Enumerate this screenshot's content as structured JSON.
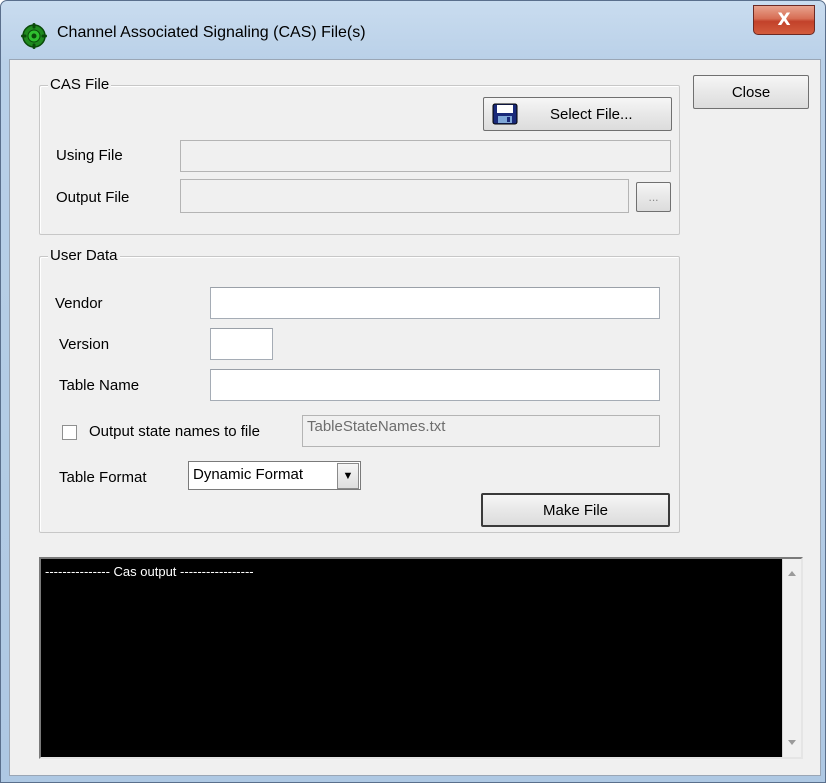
{
  "window": {
    "title": "Channel Associated Signaling (CAS) File(s)",
    "close_glyph": "X"
  },
  "close_button": {
    "label": "Close"
  },
  "cas_file": {
    "legend": "CAS File",
    "select_file_label": "Select File...",
    "using_file_label": "Using File",
    "using_file_value": "",
    "output_file_label": "Output File",
    "output_file_value": "",
    "browse_label": "..."
  },
  "user_data": {
    "legend": "User Data",
    "vendor_label": "Vendor",
    "vendor_value": "",
    "version_label": "Version",
    "version_value": "",
    "table_name_label": "Table Name",
    "table_name_value": "",
    "output_state_label": "Output state names to file",
    "output_state_checked": false,
    "state_file_value": "TableStateNames.txt",
    "table_format_label": "Table Format",
    "table_format_value": "Dynamic Format",
    "make_file_label": "Make File"
  },
  "console": {
    "text": "--------------- Cas output -----------------"
  },
  "icons": {
    "app": "gear-icon",
    "select_file": "floppy-disk-icon",
    "dropdown": "chevron-down-icon"
  },
  "colors": {
    "titlebar": "#b9d0e8",
    "close_red": "#c2412a",
    "console_bg": "#000000",
    "panel_bg": "#f0f0f0"
  }
}
